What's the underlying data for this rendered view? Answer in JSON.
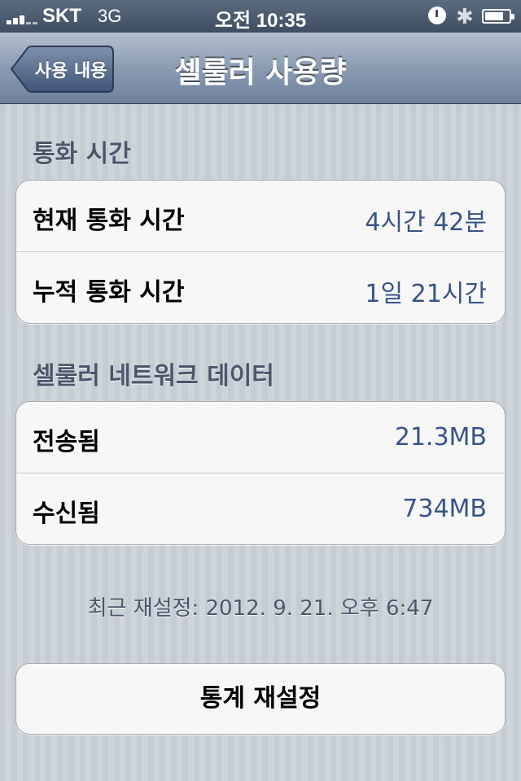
{
  "status_bar": {
    "carrier": "SKT",
    "network": "3G",
    "time": "오전 10:35",
    "bluetooth_symbol": "✱",
    "icons": [
      "signal-bars-icon",
      "alarm-clock-icon",
      "bluetooth-icon",
      "battery-icon"
    ]
  },
  "nav": {
    "back_label": "사용 내용",
    "title": "셀룰러 사용량"
  },
  "call_time": {
    "header": "통화 시간",
    "rows": [
      {
        "label": "현재 통화 시간",
        "value": "4시간 42분"
      },
      {
        "label": "누적 통화 시간",
        "value": "1일 21시간"
      }
    ]
  },
  "cellular_data": {
    "header": "셀룰러 네트워크 데이터",
    "rows": [
      {
        "label": "전송됨",
        "value": "21.3MB"
      },
      {
        "label": "수신됨",
        "value": "734MB"
      }
    ]
  },
  "last_reset": "최근 재설정: 2012. 9. 21. 오후 6:47",
  "reset_button_label": "통계 재설정",
  "colors": {
    "value_text": "#385487",
    "section_header": "#4c566c",
    "nav_bar": "#8a9bb2"
  }
}
